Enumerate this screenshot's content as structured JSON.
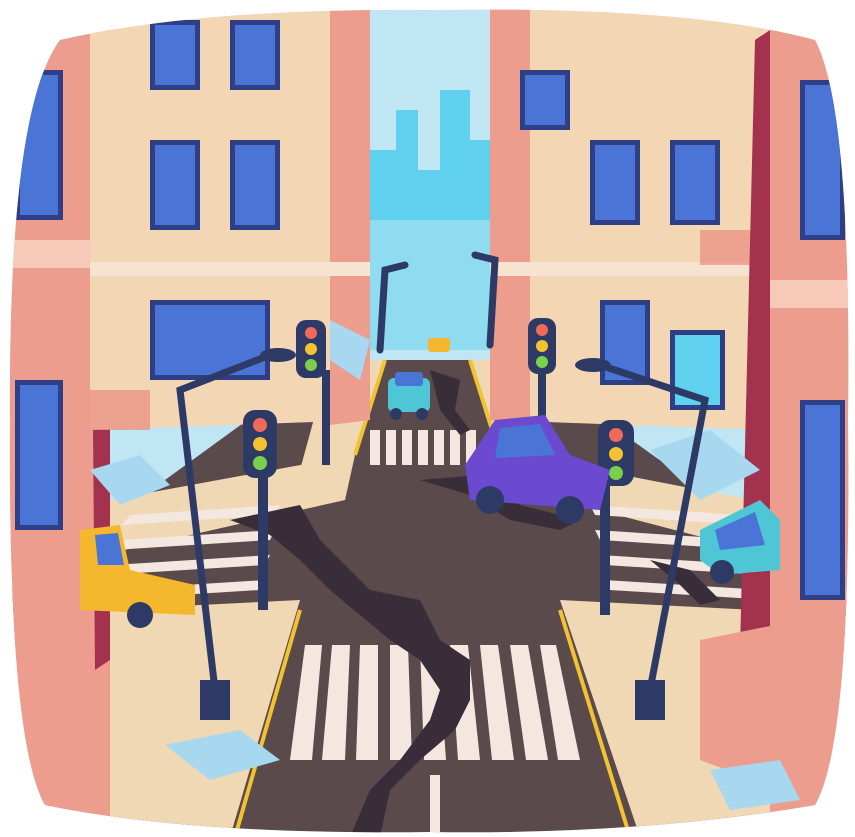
{
  "illustration": {
    "subject": "earthquake-damaged-city-intersection",
    "background": "#ffffff",
    "palette": {
      "sky": "#bfe6f2",
      "skyline": "#5fd0ee",
      "building_light": "#f3d6b4",
      "building_pink": "#ec9d8d",
      "building_shadow": "#d97b72",
      "window_frame": "#2f3f86",
      "window_glass": "#4a74d6",
      "road": "#5a4a4c",
      "sidewalk": "#f0d8b4",
      "crack": "#3a2d3a",
      "crosswalk": "#f4e7e0",
      "yellow_line": "#f2c230",
      "car_purple": "#6c4ad0",
      "car_yellow": "#f4b72d",
      "car_teal": "#4ec6d6",
      "pole": "#2e3a66",
      "light_red": "#f06a5a",
      "light_yellow": "#f2c230",
      "light_green": "#7ad04a",
      "rubble_blue": "#a8d8f0"
    },
    "icons": [
      "traffic-light-icon",
      "street-lamp-icon",
      "car-icon",
      "crack-icon"
    ]
  }
}
